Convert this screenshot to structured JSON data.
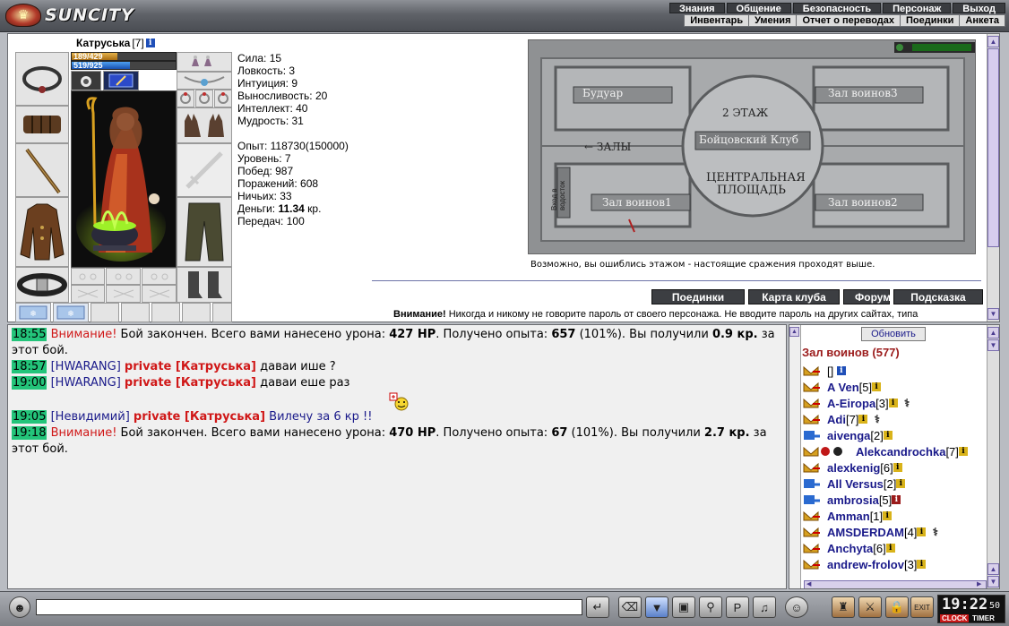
{
  "logo": {
    "text": "SUNCITY"
  },
  "top_menu": {
    "row1": [
      "Знания",
      "Общение",
      "Безопасность",
      "Персонаж",
      "Выход"
    ],
    "row2": [
      "Инвентарь",
      "Умения",
      "Отчет о переводах",
      "Поединки",
      "Анкета"
    ]
  },
  "character": {
    "name": "Катруська",
    "level": "[7]",
    "hp": "189/429",
    "hp_fraction": 0.44,
    "mp": "519/925",
    "mp_fraction": 0.56
  },
  "stats": {
    "attrs": [
      "Сила: 15",
      "Ловкость: 3",
      "Интуиция: 9",
      "Выносливость: 20",
      "Интеллект: 40",
      "Мудрость: 31"
    ],
    "exp": "Опыт: 118730(150000)",
    "level": "Уровень: 7",
    "wins": "Побед: 987",
    "losses": "Поражений: 608",
    "draws": "Ничьих: 33",
    "money_label": "Деньги: ",
    "money_value": "11.34",
    "money_unit": " кр.",
    "transfers": "Передач: 100"
  },
  "map": {
    "rooms": {
      "boudoir": "Будуар",
      "hall3": "Зал воинов3",
      "floor2": "2 ЭТАЖ",
      "club": "Бойцовский Клуб",
      "halls": "ЗАЛЫ",
      "central": "ЦЕНТРАЛЬНАЯ",
      "square": "ПЛОЩАДЬ",
      "hall1": "Зал воинов1",
      "hall2": "Зал воинов2",
      "tower": "Вход в водосток"
    },
    "note": "Возможно, вы ошиблись этажом - настоящие сражения проходят выше."
  },
  "nav_buttons": [
    "Поединки",
    "Карта клуба",
    "Форум",
    "Подсказка"
  ],
  "warning": {
    "bold": "Внимание!",
    "text": " Никогда и никому не говорите пароль от своего персонажа. Не вводите пароль на других сайтах, типа"
  },
  "chat": {
    "m1": {
      "time": "18:55",
      "warn": "Внимание!",
      "t1": " Бой закончен. Всего вами нанесено урона: ",
      "dmg": "427 HP",
      "t2": ". Получено опыта: ",
      "exp": "657",
      "t3": " (101%). Вы получили ",
      "money": "0.9 кр.",
      "t4": " за этот бой."
    },
    "m2": {
      "time": "18:57",
      "nick": "[HWARANG]",
      "priv": "private [Катруська]",
      "text": " даваи ише ?"
    },
    "m3": {
      "time": "19:00",
      "nick": "[HWARANG]",
      "priv": "private [Катруська]",
      "text": " даваи еше раз"
    },
    "m4": {
      "time": "19:05",
      "nick": "[Невидимий]",
      "priv": "private [Катруська]",
      "text": " Вилечу за 6 кр !!"
    },
    "m5": {
      "time": "19:18",
      "warn": "Внимание!",
      "t1": " Бой закончен. Всего вами нанесено урона: ",
      "dmg": "470 HP",
      "t2": ". Получено опыта: ",
      "exp": "67",
      "t3": " (101%). Вы получили ",
      "money": "2.7 кр.",
      "t4": " за этот бой."
    }
  },
  "users": {
    "refresh": "Обновить",
    "room": "Зал воинов (577)",
    "list": [
      {
        "name": "",
        "lvl": "[]"
      },
      {
        "name": "A Ven",
        "lvl": "[5]"
      },
      {
        "name": "A-Eiropa",
        "lvl": "[3]"
      },
      {
        "name": "Adi",
        "lvl": "[7]"
      },
      {
        "name": "aivenga",
        "lvl": "[2]"
      },
      {
        "name": "Alekcandrochka",
        "lvl": "[7]"
      },
      {
        "name": "alexkenig",
        "lvl": "[6]"
      },
      {
        "name": "All Versus",
        "lvl": "[2]"
      },
      {
        "name": "ambrosia",
        "lvl": "[5]"
      },
      {
        "name": "Amman",
        "lvl": "[1]"
      },
      {
        "name": "AMSDERDAM",
        "lvl": "[4]"
      },
      {
        "name": "Anchyta",
        "lvl": "[6]"
      },
      {
        "name": "andrew-frolov",
        "lvl": "[3]"
      }
    ]
  },
  "clock": {
    "time": "19:22",
    "sec": "50",
    "label1": "CLOCK",
    "label2": "TIMER"
  }
}
